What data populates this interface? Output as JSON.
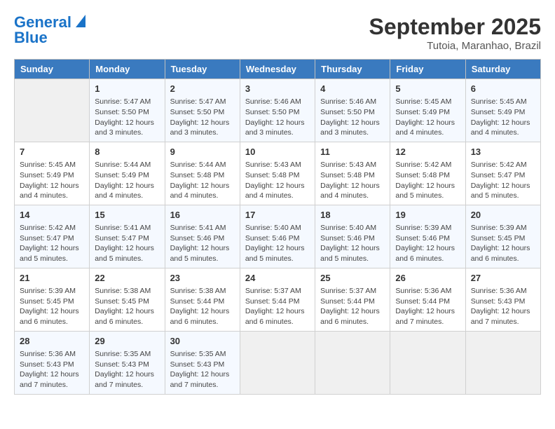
{
  "header": {
    "logo_line1": "General",
    "logo_line2": "Blue",
    "month": "September 2025",
    "location": "Tutoia, Maranhao, Brazil"
  },
  "weekdays": [
    "Sunday",
    "Monday",
    "Tuesday",
    "Wednesday",
    "Thursday",
    "Friday",
    "Saturday"
  ],
  "weeks": [
    [
      {
        "day": "",
        "info": ""
      },
      {
        "day": "1",
        "info": "Sunrise: 5:47 AM\nSunset: 5:50 PM\nDaylight: 12 hours\nand 3 minutes."
      },
      {
        "day": "2",
        "info": "Sunrise: 5:47 AM\nSunset: 5:50 PM\nDaylight: 12 hours\nand 3 minutes."
      },
      {
        "day": "3",
        "info": "Sunrise: 5:46 AM\nSunset: 5:50 PM\nDaylight: 12 hours\nand 3 minutes."
      },
      {
        "day": "4",
        "info": "Sunrise: 5:46 AM\nSunset: 5:50 PM\nDaylight: 12 hours\nand 3 minutes."
      },
      {
        "day": "5",
        "info": "Sunrise: 5:45 AM\nSunset: 5:49 PM\nDaylight: 12 hours\nand 4 minutes."
      },
      {
        "day": "6",
        "info": "Sunrise: 5:45 AM\nSunset: 5:49 PM\nDaylight: 12 hours\nand 4 minutes."
      }
    ],
    [
      {
        "day": "7",
        "info": "Sunrise: 5:45 AM\nSunset: 5:49 PM\nDaylight: 12 hours\nand 4 minutes."
      },
      {
        "day": "8",
        "info": "Sunrise: 5:44 AM\nSunset: 5:49 PM\nDaylight: 12 hours\nand 4 minutes."
      },
      {
        "day": "9",
        "info": "Sunrise: 5:44 AM\nSunset: 5:48 PM\nDaylight: 12 hours\nand 4 minutes."
      },
      {
        "day": "10",
        "info": "Sunrise: 5:43 AM\nSunset: 5:48 PM\nDaylight: 12 hours\nand 4 minutes."
      },
      {
        "day": "11",
        "info": "Sunrise: 5:43 AM\nSunset: 5:48 PM\nDaylight: 12 hours\nand 4 minutes."
      },
      {
        "day": "12",
        "info": "Sunrise: 5:42 AM\nSunset: 5:48 PM\nDaylight: 12 hours\nand 5 minutes."
      },
      {
        "day": "13",
        "info": "Sunrise: 5:42 AM\nSunset: 5:47 PM\nDaylight: 12 hours\nand 5 minutes."
      }
    ],
    [
      {
        "day": "14",
        "info": "Sunrise: 5:42 AM\nSunset: 5:47 PM\nDaylight: 12 hours\nand 5 minutes."
      },
      {
        "day": "15",
        "info": "Sunrise: 5:41 AM\nSunset: 5:47 PM\nDaylight: 12 hours\nand 5 minutes."
      },
      {
        "day": "16",
        "info": "Sunrise: 5:41 AM\nSunset: 5:46 PM\nDaylight: 12 hours\nand 5 minutes."
      },
      {
        "day": "17",
        "info": "Sunrise: 5:40 AM\nSunset: 5:46 PM\nDaylight: 12 hours\nand 5 minutes."
      },
      {
        "day": "18",
        "info": "Sunrise: 5:40 AM\nSunset: 5:46 PM\nDaylight: 12 hours\nand 5 minutes."
      },
      {
        "day": "19",
        "info": "Sunrise: 5:39 AM\nSunset: 5:46 PM\nDaylight: 12 hours\nand 6 minutes."
      },
      {
        "day": "20",
        "info": "Sunrise: 5:39 AM\nSunset: 5:45 PM\nDaylight: 12 hours\nand 6 minutes."
      }
    ],
    [
      {
        "day": "21",
        "info": "Sunrise: 5:39 AM\nSunset: 5:45 PM\nDaylight: 12 hours\nand 6 minutes."
      },
      {
        "day": "22",
        "info": "Sunrise: 5:38 AM\nSunset: 5:45 PM\nDaylight: 12 hours\nand 6 minutes."
      },
      {
        "day": "23",
        "info": "Sunrise: 5:38 AM\nSunset: 5:44 PM\nDaylight: 12 hours\nand 6 minutes."
      },
      {
        "day": "24",
        "info": "Sunrise: 5:37 AM\nSunset: 5:44 PM\nDaylight: 12 hours\nand 6 minutes."
      },
      {
        "day": "25",
        "info": "Sunrise: 5:37 AM\nSunset: 5:44 PM\nDaylight: 12 hours\nand 6 minutes."
      },
      {
        "day": "26",
        "info": "Sunrise: 5:36 AM\nSunset: 5:44 PM\nDaylight: 12 hours\nand 7 minutes."
      },
      {
        "day": "27",
        "info": "Sunrise: 5:36 AM\nSunset: 5:43 PM\nDaylight: 12 hours\nand 7 minutes."
      }
    ],
    [
      {
        "day": "28",
        "info": "Sunrise: 5:36 AM\nSunset: 5:43 PM\nDaylight: 12 hours\nand 7 minutes."
      },
      {
        "day": "29",
        "info": "Sunrise: 5:35 AM\nSunset: 5:43 PM\nDaylight: 12 hours\nand 7 minutes."
      },
      {
        "day": "30",
        "info": "Sunrise: 5:35 AM\nSunset: 5:43 PM\nDaylight: 12 hours\nand 7 minutes."
      },
      {
        "day": "",
        "info": ""
      },
      {
        "day": "",
        "info": ""
      },
      {
        "day": "",
        "info": ""
      },
      {
        "day": "",
        "info": ""
      }
    ]
  ]
}
